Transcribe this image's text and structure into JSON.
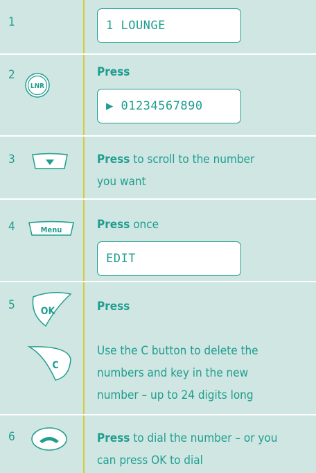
{
  "steps": [
    {
      "number": "1",
      "display": "1 LOUNGE"
    },
    {
      "number": "2",
      "icon_label": "LNR",
      "press": "Press",
      "display": "▶ 01234567890"
    },
    {
      "number": "3",
      "press": "Press",
      "text_line1": " to scroll to the number",
      "text_line2": "you want"
    },
    {
      "number": "4",
      "icon_label": "Menu",
      "press": "Press",
      "text": " once",
      "display": "EDIT"
    },
    {
      "number": "5",
      "icon_label": "OK",
      "press": "Press",
      "icon2_label": "C",
      "text_line1": "Use the C button to delete the",
      "text_line2": "numbers and key in the new",
      "text_line3": "number – up to 24 digits long"
    },
    {
      "number": "6",
      "press": "Press",
      "text_line1": " to dial the number – or you",
      "text_line2": "can press OK to dial"
    }
  ],
  "colors": {
    "background": "#cfe6e2",
    "accent": "#1f9d8f",
    "divider": "#d6cc38",
    "display_bg": "#ffffff"
  },
  "icons": [
    "lnr-button-icon",
    "down-arrow-button-icon",
    "menu-button-icon",
    "ok-button-icon",
    "c-button-icon",
    "talk-button-icon"
  ]
}
